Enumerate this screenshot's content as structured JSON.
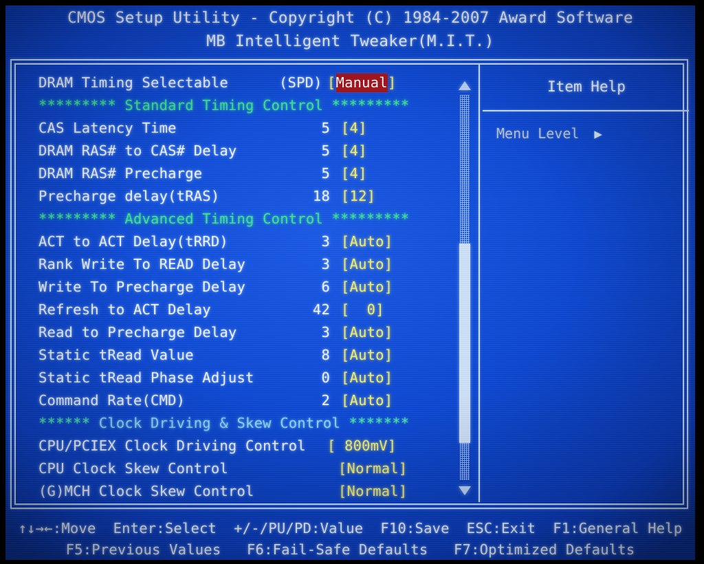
{
  "header": {
    "title": "CMOS Setup Utility - Copyright (C) 1984-2007 Award Software",
    "subtitle": "MB Intelligent Tweaker(M.I.T.)"
  },
  "colors": {
    "screen_blue": "#0b46d2",
    "text_white": "#f2f7ff",
    "value_yellow": "#f2f06a",
    "separator_green": "#3ce58f",
    "separator_cyan": "#8fd8f5",
    "selection_red": "#a4131b",
    "frame_line": "#cfe4ff",
    "help_dim_gray": "#b9c6d8"
  },
  "options": [
    {
      "type": "item",
      "label": "DRAM Timing Selectable",
      "current": "(SPD)",
      "setting": "Manual",
      "selected": true,
      "layout": "attached"
    },
    {
      "type": "separator",
      "stars_left": "*********",
      "text": " Standard Timing Control ",
      "stars_right": "*********",
      "style": "green"
    },
    {
      "type": "item",
      "label": "CAS Latency Time",
      "current": "5",
      "setting": "4",
      "selected": false
    },
    {
      "type": "item",
      "label": "DRAM RAS# to CAS# Delay",
      "current": "5",
      "setting": "4",
      "selected": false
    },
    {
      "type": "item",
      "label": "DRAM RAS# Precharge",
      "current": "5",
      "setting": "4",
      "selected": false
    },
    {
      "type": "item",
      "label": "Precharge delay(tRAS)",
      "current": "18",
      "setting": "12",
      "selected": false
    },
    {
      "type": "separator",
      "stars_left": "*********",
      "text": " Advanced Timing Control ",
      "stars_right": "*********",
      "style": "green"
    },
    {
      "type": "item",
      "label": "ACT to ACT Delay(tRRD)",
      "current": "3",
      "setting": "Auto",
      "selected": false
    },
    {
      "type": "item",
      "label": "Rank Write To READ Delay",
      "current": "3",
      "setting": "Auto",
      "selected": false
    },
    {
      "type": "item",
      "label": "Write To Precharge Delay",
      "current": "6",
      "setting": "Auto",
      "selected": false
    },
    {
      "type": "item",
      "label": "Refresh to ACT Delay",
      "current": "42",
      "setting": "  0",
      "selected": false
    },
    {
      "type": "item",
      "label": "Read to Precharge Delay",
      "current": "3",
      "setting": "Auto",
      "selected": false
    },
    {
      "type": "item",
      "label": "Static tRead Value",
      "current": "8",
      "setting": "Auto",
      "selected": false
    },
    {
      "type": "item",
      "label": "Static tRead Phase Adjust",
      "current": "0",
      "setting": "Auto",
      "selected": false
    },
    {
      "type": "item",
      "label": "Command Rate(CMD)",
      "current": "2",
      "setting": "Auto",
      "selected": false
    },
    {
      "type": "separator",
      "stars_left": "******",
      "text": " Clock Driving & Skew Control ",
      "stars_right": "*******",
      "style": "cyan"
    },
    {
      "type": "item",
      "label": "CPU/PCIEX Clock Driving Control",
      "current": "",
      "setting": " 800mV",
      "selected": false,
      "layout": "attached"
    },
    {
      "type": "item",
      "label": "CPU Clock Skew Control",
      "current": "",
      "setting": "Normal",
      "selected": false,
      "layout": "wide"
    },
    {
      "type": "item",
      "label": "(G)MCH Clock Skew Control",
      "current": "",
      "setting": "Normal",
      "selected": false,
      "layout": "wide"
    }
  ],
  "scrollbar": {
    "up_arrow": "▲",
    "down_arrow": "▼"
  },
  "help": {
    "title": "Item Help",
    "menu_level_label": "Menu Level",
    "menu_level_arrow": "▶"
  },
  "keybar": {
    "line1": "↑↓→←:Move  Enter:Select  +/-/PU/PD:Value  F10:Save  ESC:Exit  F1:General Help",
    "line2": "F5:Previous Values   F6:Fail-Safe Defaults   F7:Optimized Defaults"
  }
}
